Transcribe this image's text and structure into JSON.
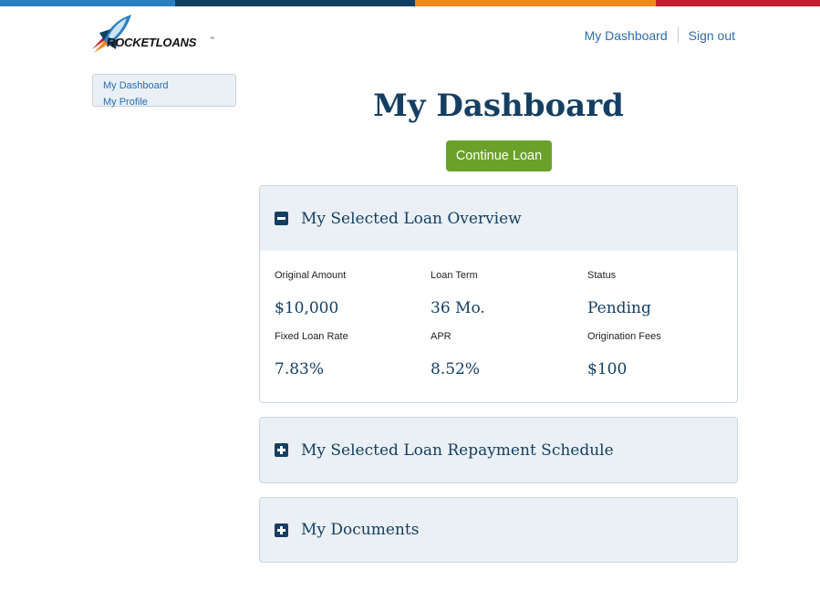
{
  "brand": {
    "logo_text": "ROCKETLOANS",
    "logo_tm": "™",
    "stripe_colors": [
      "#2a7fc1",
      "#103f61",
      "#ee8b1c",
      "#c41e2e"
    ]
  },
  "header": {
    "nav": [
      {
        "label": "My Dashboard"
      },
      {
        "label": "Sign out"
      }
    ]
  },
  "sidebar": {
    "items": [
      {
        "label": "My Dashboard"
      },
      {
        "label": "My Profile"
      }
    ]
  },
  "main": {
    "title": "My Dashboard",
    "continue_button": "Continue Loan",
    "panels": [
      {
        "title": "My Selected Loan Overview",
        "state": "expanded",
        "icon": "minus-square-icon",
        "fields": [
          {
            "label": "Original Amount",
            "value": "$10,000"
          },
          {
            "label": "Loan Term",
            "value": "36 Mo."
          },
          {
            "label": "Status",
            "value": "Pending"
          },
          {
            "label": "Fixed Loan Rate",
            "value": "7.83%"
          },
          {
            "label": "APR",
            "value": "8.52%"
          },
          {
            "label": "Origination Fees",
            "value": "$100"
          }
        ]
      },
      {
        "title": "My Selected Loan Repayment Schedule",
        "state": "collapsed",
        "icon": "plus-square-icon"
      },
      {
        "title": "My Documents",
        "state": "collapsed",
        "icon": "plus-square-icon"
      }
    ]
  }
}
